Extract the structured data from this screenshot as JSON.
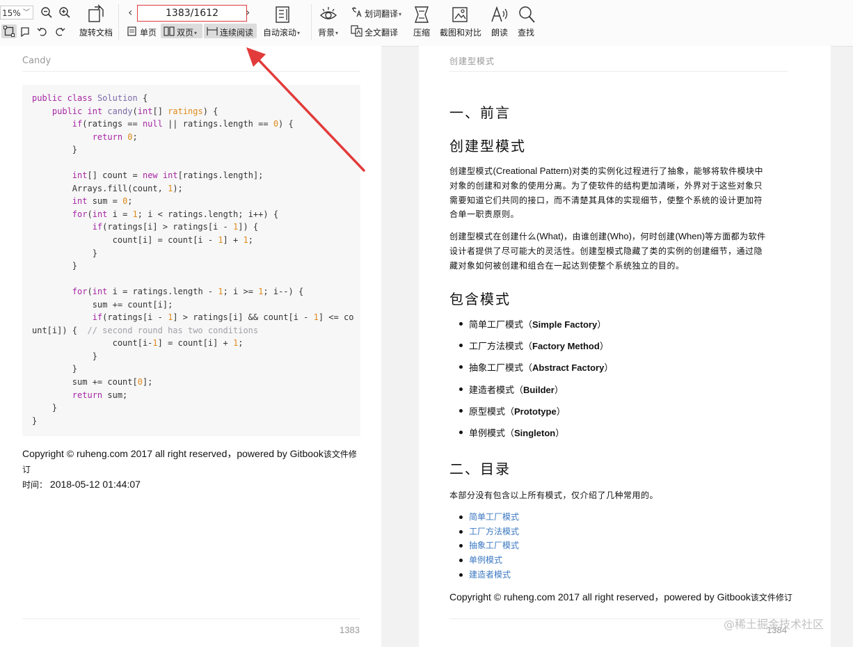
{
  "toolbar": {
    "zoom": "15%",
    "rotate_label": "旋转文档",
    "page_indicator": "1383/1612",
    "single_page_label": "单页",
    "double_page_label": "双页",
    "continuous_label": "连续阅读",
    "auto_scroll_label": "自动滚动",
    "background_label": "背景",
    "word_translate_label": "划词翻译",
    "full_translate_label": "全文翻译",
    "compress_label": "压缩",
    "screenshot_label": "截图和对比",
    "read_aloud_label": "朗读",
    "find_label": "查找"
  },
  "left_page": {
    "running_head": "Candy",
    "code_lines": [
      "public class Solution {",
      "    public int candy(int[] ratings) {",
      "        if(ratings == null || ratings.length == 0) {",
      "            return 0;",
      "        }",
      "",
      "        int[] count = new int[ratings.length];",
      "        Arrays.fill(count, 1);",
      "        int sum = 0;",
      "        for(int i = 1; i < ratings.length; i++) {",
      "            if(ratings[i] > ratings[i - 1]) {",
      "                count[i] = count[i - 1] + 1;",
      "            }",
      "        }",
      "",
      "        for(int i = ratings.length - 1; i >= 1; i--) {",
      "            sum += count[i];",
      "            if(ratings[i - 1] > ratings[i] && count[i - 1] <= co",
      "unt[i]) {  // second round has two conditions",
      "                count[i-1] = count[i] + 1;",
      "            }",
      "        }",
      "        sum += count[0];",
      "        return sum;",
      "    }",
      "}"
    ],
    "footer_line1": "Copyright © ruheng.com 2017 all right reserved，powered by Gitbook",
    "footer_line1_cn": "该文件修订",
    "footer_line2_cn": "时间：",
    "footer_line2": " 2018-05-12 01:44:07",
    "page_number": "1383"
  },
  "right_page": {
    "running_head": "创建型模式",
    "h_preface": "一、前言",
    "h_creational": "创建型模式",
    "para1_lines": [
      [
        "创建型模式",
        "(Creational Pattern)",
        "对类的实例化过程进行了抽象，能够将软件模块中"
      ],
      [
        "对象的创建和对象的使用分离。为了使软件的结构更加清晰，外界对于这些对象只",
        "",
        ""
      ],
      [
        "需要知道它们共同的接口，而不清楚其具体的实现细节，使整个系统的设计更加符",
        "",
        ""
      ],
      [
        "合单一职责原则。",
        "",
        ""
      ]
    ],
    "para2_lines": [
      [
        "创建型模式在创建什么",
        "(What)",
        "，由谁创建",
        "(Who)",
        "，何时创建",
        "(When)",
        "等方面都为软件"
      ],
      [
        "设计者提供了尽可能大的灵活性。创建型模式隐藏了类的实例的创建细节，通过隐",
        "",
        "",
        "",
        "",
        "",
        ""
      ],
      [
        "藏对象如何被创建和组合在一起达到使整个系统独立的目的。",
        "",
        "",
        "",
        "",
        "",
        ""
      ]
    ],
    "h_contains": "包含模式",
    "patterns": [
      {
        "cn": "简单工厂模式（",
        "en": "Simple Factory",
        "end": "）"
      },
      {
        "cn": "工厂方法模式（",
        "en": "Factory Method",
        "end": "）"
      },
      {
        "cn": "抽象工厂模式（",
        "en": "Abstract Factory",
        "end": "）"
      },
      {
        "cn": "建造者模式（",
        "en": "Builder",
        "end": "）"
      },
      {
        "cn": "原型模式（",
        "en": "Prototype",
        "end": "）"
      },
      {
        "cn": "单例模式（",
        "en": "Singleton",
        "end": "）"
      }
    ],
    "h_toc": "二、目录",
    "toc_intro": "本部分没有包含以上所有模式，仅介绍了几种常用的。",
    "toc_links": [
      "简单工厂模式",
      "工厂方法模式",
      "抽象工厂模式",
      "单例模式",
      "建造者模式"
    ],
    "footer_line1": "Copyright © ruheng.com 2017 all right reserved，powered by Gitbook",
    "footer_line1_cn": "该文件修订",
    "page_number": "1384"
  },
  "watermark": "@稀土掘金技术社区",
  "colors": {
    "annotation_red": "#e23b3b",
    "link_blue": "#3b78c2",
    "keyword": "#a626a4",
    "number": "#e08a1a"
  }
}
